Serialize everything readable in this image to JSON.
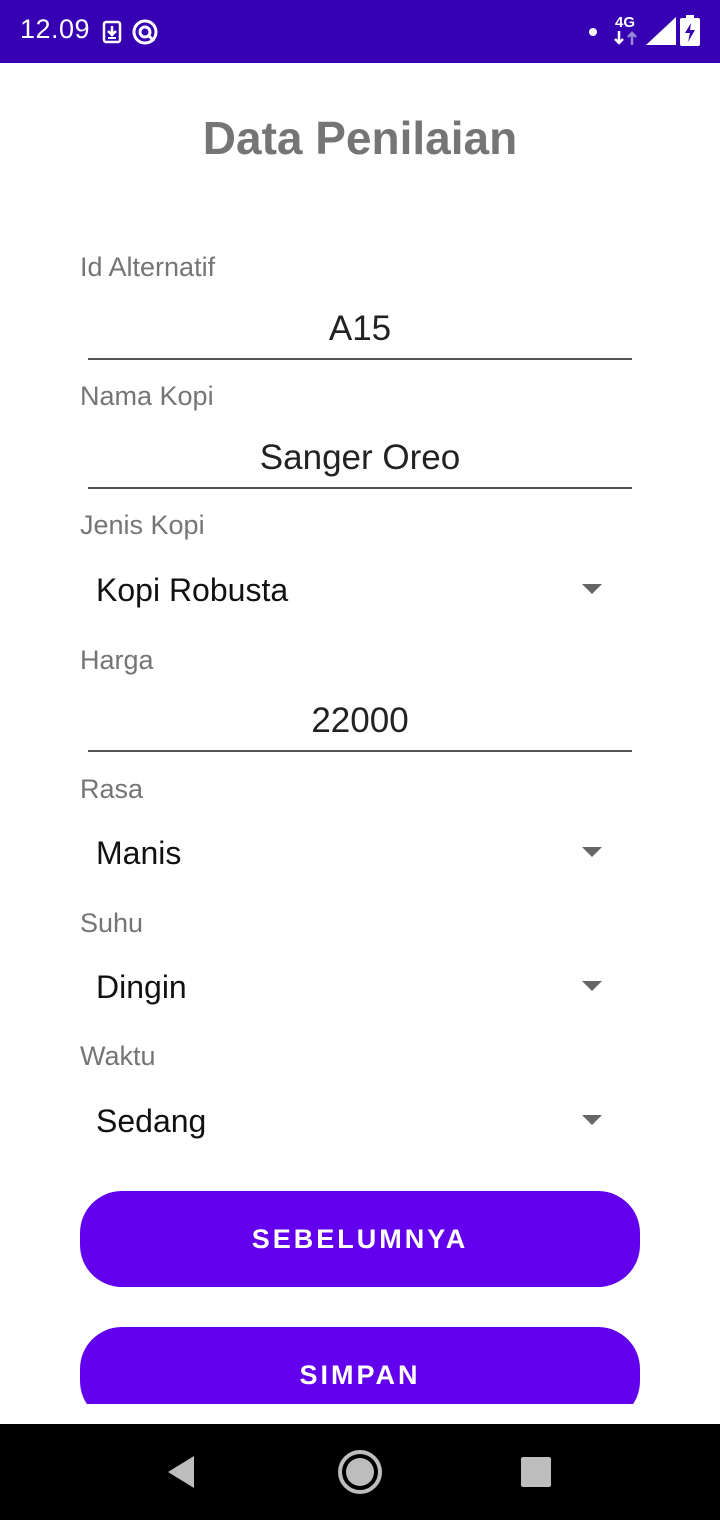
{
  "status_bar": {
    "time": "12.09",
    "network_label": "4G",
    "icons": [
      "download-icon",
      "vpn-icon",
      "notification-dot-icon",
      "data-arrows-icon",
      "signal-icon",
      "battery-charging-icon"
    ]
  },
  "screen": {
    "title": "Data Penilaian",
    "fields": {
      "id_alternatif": {
        "label": "Id Alternatif",
        "value": "A15"
      },
      "nama_kopi": {
        "label": "Nama Kopi",
        "value": "Sanger Oreo"
      },
      "jenis_kopi": {
        "label": "Jenis Kopi",
        "value": "Kopi Robusta"
      },
      "harga": {
        "label": "Harga",
        "value": "22000"
      },
      "rasa": {
        "label": "Rasa",
        "value": "Manis"
      },
      "suhu": {
        "label": "Suhu",
        "value": "Dingin"
      },
      "waktu": {
        "label": "Waktu",
        "value": "Sedang"
      }
    },
    "buttons": {
      "previous": "SEBELUMNYA",
      "save": "SIMPAN"
    },
    "colors": {
      "primary": "#6200ee",
      "status_bar": "#3700b3",
      "label": "#757575"
    }
  },
  "nav_bar": {
    "icons": [
      "back-icon",
      "home-icon",
      "recents-icon"
    ]
  }
}
